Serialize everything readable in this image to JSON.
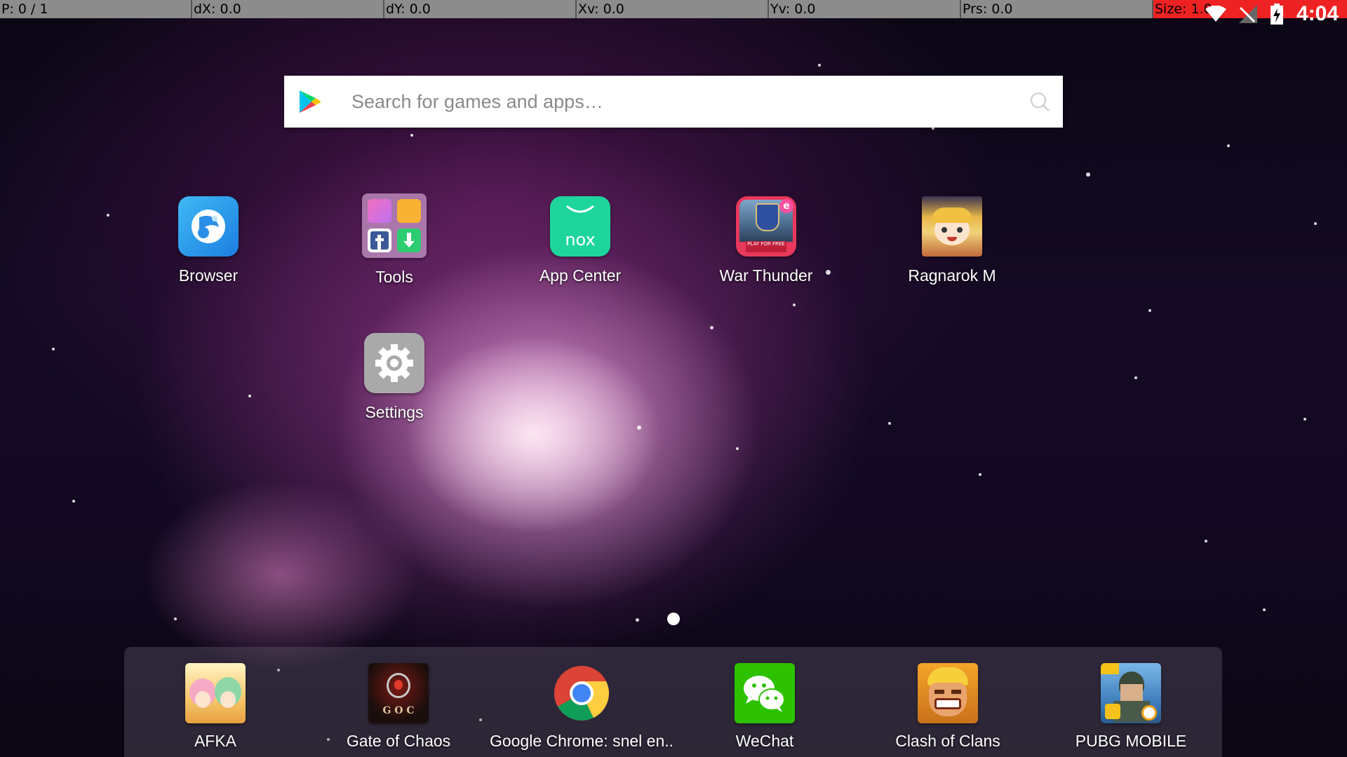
{
  "pointer_bar": {
    "p": "P: 0 / 1",
    "dx": "dX: 0.0",
    "dy": "dY: 0.0",
    "xv": "Xv: 0.0",
    "yv": "Yv: 0.0",
    "prs": "Prs: 0.0",
    "size": "Size: 1.0"
  },
  "status_bar": {
    "time": "4:04",
    "icons": [
      "wifi-icon",
      "signal-icon",
      "battery-charging-icon"
    ]
  },
  "search": {
    "placeholder": "Search for games and apps…",
    "value": ""
  },
  "home_apps": [
    {
      "label": "Browser",
      "icon": "browser-icon"
    },
    {
      "label": "Tools",
      "icon": "tools-folder-icon"
    },
    {
      "label": "App Center",
      "icon": "nox-app-center-icon"
    },
    {
      "label": "War Thunder",
      "icon": "war-thunder-icon"
    },
    {
      "label": "Ragnarok M",
      "icon": "ragnarok-m-icon"
    },
    {
      "label": "Settings",
      "icon": "settings-gear-icon"
    }
  ],
  "dock_apps": [
    {
      "label": "AFKA",
      "icon": "afka-icon"
    },
    {
      "label": "Gate of Chaos",
      "icon": "gate-of-chaos-icon"
    },
    {
      "label": "Google Chrome: snel en..",
      "icon": "chrome-icon"
    },
    {
      "label": "WeChat",
      "icon": "wechat-icon"
    },
    {
      "label": "Clash of Clans",
      "icon": "clash-of-clans-icon"
    },
    {
      "label": "PUBG MOBILE",
      "icon": "pubg-mobile-icon"
    }
  ],
  "war_thunder_badge": "PLAY FOR FREE",
  "gate_of_chaos_badge": "G O C",
  "colors": {
    "pointer_bar_bg": "#8c8c8c",
    "size_cell_bg": "#ee2222",
    "nox_green": "#1ed69c",
    "wechat_green": "#2dc100"
  }
}
